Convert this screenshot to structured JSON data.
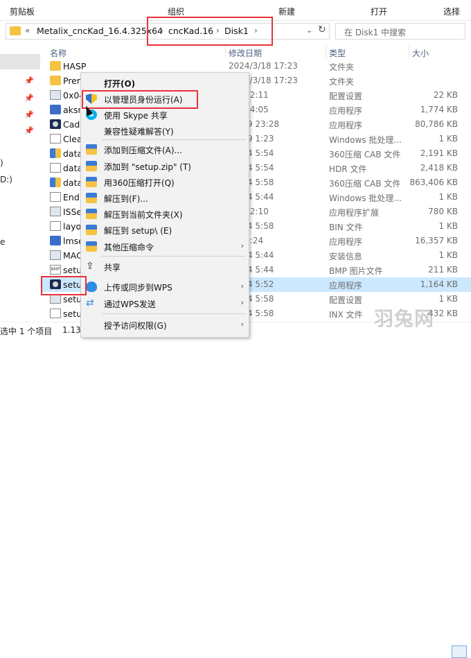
{
  "ribbon": {
    "groups": [
      "剪贴板",
      "组织",
      "新建",
      "打开",
      "选择"
    ]
  },
  "address": {
    "prefix_chevron": "«",
    "crumbs": [
      "Metalix_cncKad_16.4.325x64",
      "cncKad.16",
      "Disk1"
    ],
    "separators": [
      "›",
      "›",
      "›"
    ],
    "dropdown": "⌄",
    "refresh": "↻"
  },
  "search": {
    "placeholder": "在 Disk1 中搜索",
    "icon": "search-icon"
  },
  "nav": {
    "drives": [
      ")",
      "D:)",
      "e"
    ]
  },
  "columns": {
    "name": "名称",
    "date": "修改日期",
    "type": "类型",
    "size": "大小"
  },
  "files": [
    {
      "name": "HASP",
      "date": "2024/3/18 17:23",
      "type": "文件夹",
      "size": "",
      "icon": "folder"
    },
    {
      "name": "Prere",
      "date": "2024/3/18 17:23",
      "type": "文件夹",
      "size": "",
      "icon": "folder"
    },
    {
      "name": "0x04",
      "date": "10/2 2:11",
      "type": "配置设置",
      "size": "22 KB",
      "icon": "cfg"
    },
    {
      "name": "aksm",
      "date": "5/20 4:05",
      "type": "应用程序",
      "size": "1,774 KB",
      "icon": "exe"
    },
    {
      "name": "Cad",
      "date": "10/19 23:28",
      "type": "应用程序",
      "size": "80,786 KB",
      "icon": "cd"
    },
    {
      "name": "Clea",
      "date": "11/19 1:23",
      "type": "Windows 批处理...",
      "size": "1 KB",
      "icon": "file"
    },
    {
      "name": "data",
      "date": "11/14 5:54",
      "type": "360压缩 CAB 文件",
      "size": "2,191 KB",
      "icon": "cab"
    },
    {
      "name": "data",
      "date": "11/14 5:54",
      "type": "HDR 文件",
      "size": "2,418 KB",
      "icon": "file"
    },
    {
      "name": "data",
      "date": "11/14 5:58",
      "type": "360压缩 CAB 文件",
      "size": "863,406 KB",
      "icon": "cab"
    },
    {
      "name": "End",
      "date": "11/14 5:44",
      "type": "Windows 批处理...",
      "size": "1 KB",
      "icon": "file"
    },
    {
      "name": "ISSe",
      "date": "4/13 2:10",
      "type": "应用程序扩展",
      "size": "780 KB",
      "icon": "cfg"
    },
    {
      "name": "layo",
      "date": "11/14 5:58",
      "type": "BIN 文件",
      "size": "1 KB",
      "icon": "file"
    },
    {
      "name": "lmse",
      "date": "5/1 8:24",
      "type": "应用程序",
      "size": "16,357 KB",
      "icon": "exe"
    },
    {
      "name": "MAC",
      "date": "11/14 5:44",
      "type": "安装信息",
      "size": "1 KB",
      "icon": "cfg"
    },
    {
      "name": "setu",
      "date": "11/14 5:44",
      "type": "BMP 图片文件",
      "size": "211 KB",
      "icon": "bmp"
    },
    {
      "name": "setup",
      "date": "11/14 5:52",
      "type": "应用程序",
      "size": "1,164 KB",
      "icon": "cd"
    },
    {
      "name": "setu",
      "date": "11/14 5:58",
      "type": "配置设置",
      "size": "1 KB",
      "icon": "cfg"
    },
    {
      "name": "setu",
      "date": "11/14 5:58",
      "type": "INX 文件",
      "size": "432 KB",
      "icon": "file"
    }
  ],
  "status": {
    "count": "选中 1 个项目",
    "size": "1.13 M"
  },
  "context_menu": {
    "items": [
      {
        "label": "打开(O)",
        "icon": "",
        "bold": true,
        "arrow": false
      },
      {
        "label": "以管理员身份运行(A)",
        "icon": "shield-icon",
        "bold": false,
        "arrow": false
      },
      {
        "label": "使用 Skype 共享",
        "icon": "skype-icon",
        "bold": false,
        "arrow": false
      },
      {
        "label": "兼容性疑难解答(Y)",
        "icon": "",
        "bold": false,
        "arrow": false
      },
      {
        "label": "添加到压缩文件(A)...",
        "icon": "zip-icon",
        "bold": false,
        "arrow": false
      },
      {
        "label": "添加到 \"setup.zip\" (T)",
        "icon": "zip-icon",
        "bold": false,
        "arrow": false
      },
      {
        "label": "用360压缩打开(Q)",
        "icon": "zip-icon",
        "bold": false,
        "arrow": false
      },
      {
        "label": "解压到(F)...",
        "icon": "zip-icon",
        "bold": false,
        "arrow": false
      },
      {
        "label": "解压到当前文件夹(X)",
        "icon": "zip-icon",
        "bold": false,
        "arrow": false
      },
      {
        "label": "解压到 setup\\ (E)",
        "icon": "zip-icon",
        "bold": false,
        "arrow": false
      },
      {
        "label": "其他压缩命令",
        "icon": "zip-icon",
        "bold": false,
        "arrow": true
      },
      {
        "label": "共享",
        "icon": "share-icon",
        "bold": false,
        "arrow": false
      },
      {
        "label": "上传或同步到WPS",
        "icon": "cloud-icon",
        "bold": false,
        "arrow": true
      },
      {
        "label": "通过WPS发送",
        "icon": "wps-send-icon",
        "bold": false,
        "arrow": true
      },
      {
        "label": "授予访问权限(G)",
        "icon": "",
        "bold": false,
        "arrow": true
      }
    ],
    "arrow_glyph": "›",
    "skype_letter": "S",
    "share_glyph": "⇪",
    "wps_glyph": "⇄"
  },
  "watermark": "羽兔网",
  "colors": {
    "highlight": "#e8313a",
    "selection": "#cce8ff",
    "menu_bg": "#f2f2f2"
  }
}
